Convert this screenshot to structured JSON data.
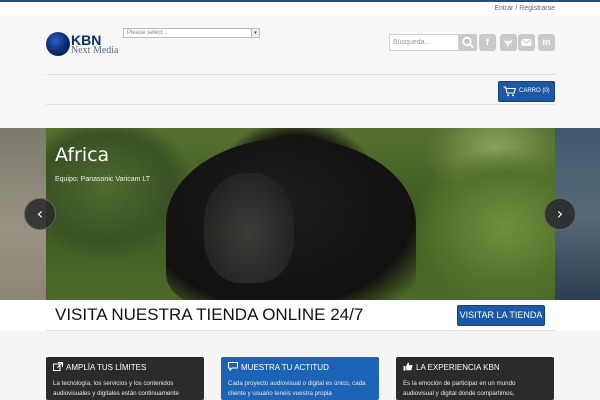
{
  "topbar": {
    "login_link": "Entrar / Registrarse"
  },
  "header": {
    "logo_main": "KBN",
    "logo_sub": "Next Media",
    "lang_select_value": "Please select...",
    "search_placeholder": "Búsqueda..."
  },
  "social": {
    "facebook": "f",
    "linkedin": "in"
  },
  "cart": {
    "label": "CARRO (0)"
  },
  "slider": {
    "title": "Africa",
    "caption": "Equipo: Panasonic Varicam LT",
    "prev": "‹",
    "next": "›"
  },
  "promo": {
    "text": "VISITA NUESTRA TIENDA ONLINE 24/7",
    "button": "VISITAR LA TIENDA"
  },
  "features": [
    {
      "title": "AMPLÍA TUS LÍMITES",
      "text": "La tecnología, los servicios y los contenidos audiovisuales y digitales están continuamente",
      "icon": "external-link-icon"
    },
    {
      "title": "MUESTRA TU ACTITUD",
      "text": "Cada proyecto audiovisual o digital es único, cada cliente y usuario tenéis vuestra propia",
      "icon": "speech-bubble-icon"
    },
    {
      "title": "LA EXPERIENCIA KBN",
      "text": "Es la emoción de participar en un mundo audiovisual y digital donde compartimos,",
      "icon": "thumbs-up-icon"
    }
  ],
  "colors": {
    "accent": "#1d58a5",
    "dark_box": "#2b2b2b",
    "blue_box": "#1d63b6",
    "top_strip": "#1c4f83"
  }
}
